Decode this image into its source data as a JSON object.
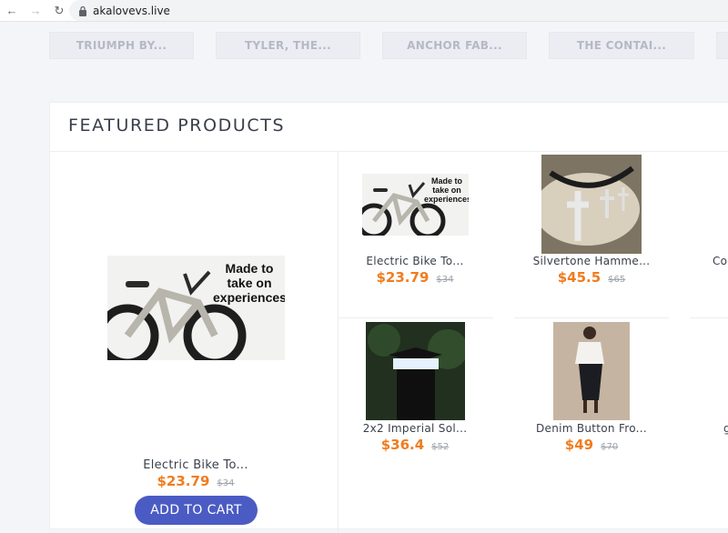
{
  "browser": {
    "url": "akalovevs.live",
    "back_icon": "back-arrow-icon",
    "forward_icon": "forward-arrow-icon",
    "reload_icon": "reload-icon",
    "lock_icon": "lock-icon"
  },
  "categories": [
    "TRIUMPH BY...",
    "TYLER, THE...",
    "ANCHOR FAB...",
    "THE CONTAI..."
  ],
  "featured": {
    "title": "FEATURED PRODUCTS",
    "main_product": {
      "name": "Electric Bike To...",
      "price": "$23.79",
      "old_price": "$34",
      "image_text": [
        "Made to",
        "take on",
        "experiences"
      ],
      "cart_label": "ADD TO CART"
    },
    "products": [
      {
        "name": "Electric Bike To...",
        "price": "$23.79",
        "old_price": "$34",
        "image_text": [
          "Made to",
          "take on",
          "experiences"
        ]
      },
      {
        "name": "Silvertone Hamme...",
        "price": "$45.5",
        "old_price": "$65"
      },
      {
        "name": "2x2 Imperial Sol...",
        "price": "$36.4",
        "old_price": "$52"
      },
      {
        "name": "Denim Button Fro...",
        "price": "$49",
        "old_price": "$70"
      }
    ],
    "clipped_right_name": "Co",
    "clipped_right_name_2": "g"
  },
  "colors": {
    "accent_price": "#f07c1e",
    "button": "#4b5bc4"
  }
}
